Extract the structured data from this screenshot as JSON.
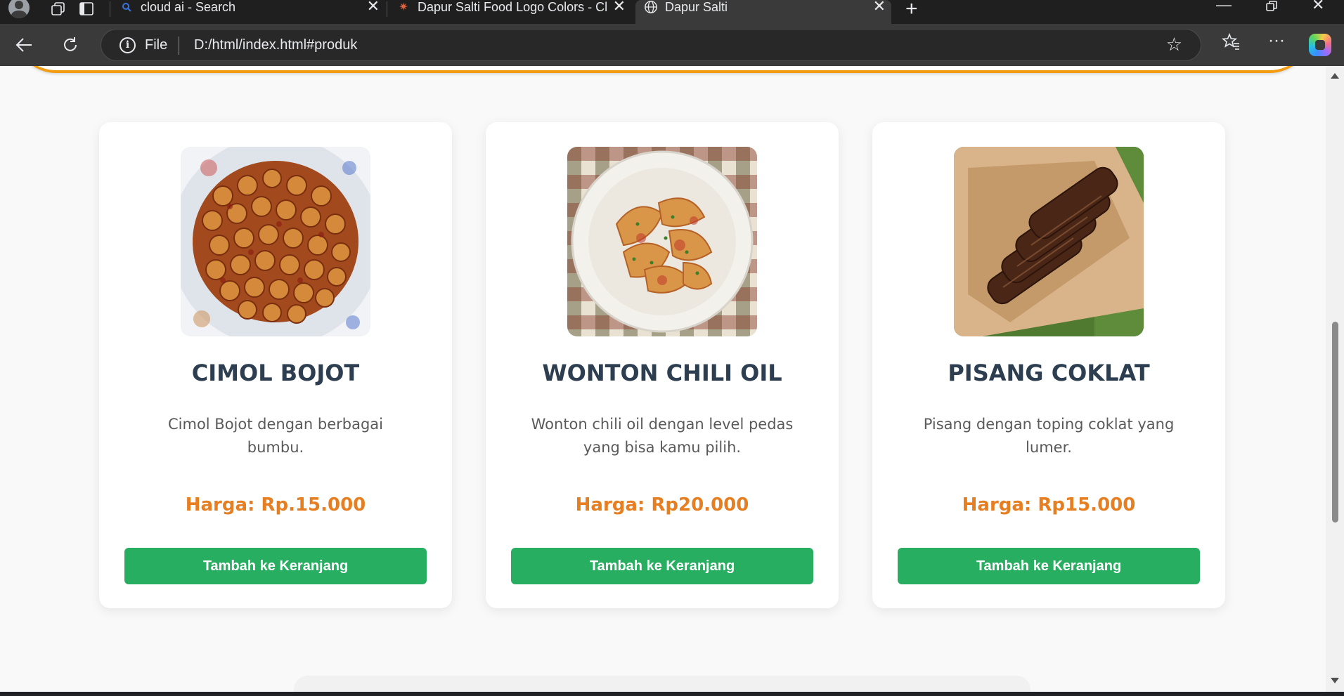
{
  "browser": {
    "tabs": [
      {
        "title": "cloud ai - Search",
        "favicon": "search-icon"
      },
      {
        "title": "Dapur Salti Food Logo Colors - Cl",
        "favicon": "sparkle-icon"
      },
      {
        "title": "Dapur Salti",
        "favicon": "globe-icon"
      }
    ],
    "active_tab": 2,
    "address": {
      "scheme_label": "File",
      "url": "D:/html/index.html#produk"
    }
  },
  "page": {
    "accent_color": "#f39c12",
    "products": [
      {
        "name": "CIMOL BOJOT",
        "description": "Cimol Bojot dengan berbagai bumbu.",
        "price": "Harga: Rp.15.000",
        "button": "Tambah ke Keranjang"
      },
      {
        "name": "WONTON CHILI OIL",
        "description": "Wonton chili oil dengan level pedas yang bisa kamu pilih.",
        "price": "Harga: Rp20.000",
        "button": "Tambah ke Keranjang"
      },
      {
        "name": "PISANG COKLAT",
        "description": "Pisang dengan toping coklat yang lumer.",
        "price": "Harga: Rp15.000",
        "button": "Tambah ke Keranjang"
      }
    ],
    "colors": {
      "title": "#2c3e50",
      "price": "#e67e22",
      "button": "#27ae60"
    }
  }
}
